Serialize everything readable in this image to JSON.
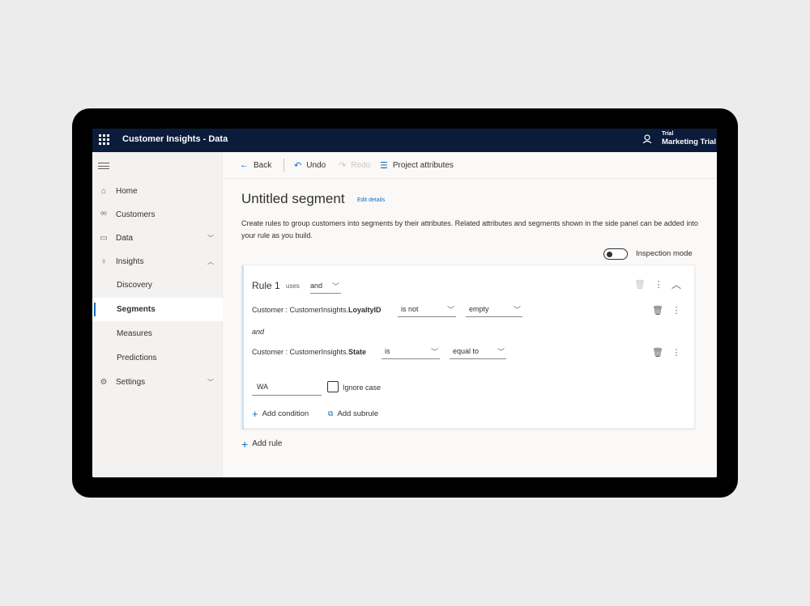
{
  "app": {
    "title": "Customer Insights - Data"
  },
  "environment": {
    "line1": "Trial",
    "line2": "Marketing Trial"
  },
  "sidebar": {
    "items": [
      {
        "label": "Home",
        "icon": "home-icon"
      },
      {
        "label": "Customers",
        "icon": "customers-icon"
      },
      {
        "label": "Data",
        "icon": "data-icon"
      },
      {
        "label": "Insights",
        "icon": "lightbulb-icon"
      },
      {
        "label": "Discovery"
      },
      {
        "label": "Segments"
      },
      {
        "label": "Measures"
      },
      {
        "label": "Predictions"
      },
      {
        "label": "Settings",
        "icon": "gear-icon"
      }
    ]
  },
  "toolbar": {
    "back_label": "Back",
    "undo_label": "Undo",
    "redo_label": "Redo",
    "project_label": "Project attributes"
  },
  "page": {
    "title": "Untitled segment",
    "edit_details": "Edit details",
    "description": "Create rules to group customers into segments by their attributes. Related attributes and segments shown in the side panel can be added into your rule as you build.",
    "inspection_mode_label": "Inspection mode",
    "inspection_mode_on": false
  },
  "rule": {
    "title": "Rule 1",
    "uses_label": "uses",
    "operator": "and",
    "conditions": [
      {
        "prefix": "Customer : CustomerInsights.",
        "attribute": "LoyaltyID",
        "operator": "is not",
        "value": "empty"
      },
      {
        "prefix": "Customer : CustomerInsights.",
        "attribute": "State",
        "operator": "is",
        "value": "equal to"
      }
    ],
    "and_label": "and",
    "value_input": "WA",
    "ignore_case_label": "Ignore case",
    "add_condition_label": "Add condition",
    "add_subrule_label": "Add subrule"
  },
  "add_rule_label": "Add rule",
  "colors": {
    "topbar": "#0b1b3a",
    "accent": "#0f6cbd"
  }
}
